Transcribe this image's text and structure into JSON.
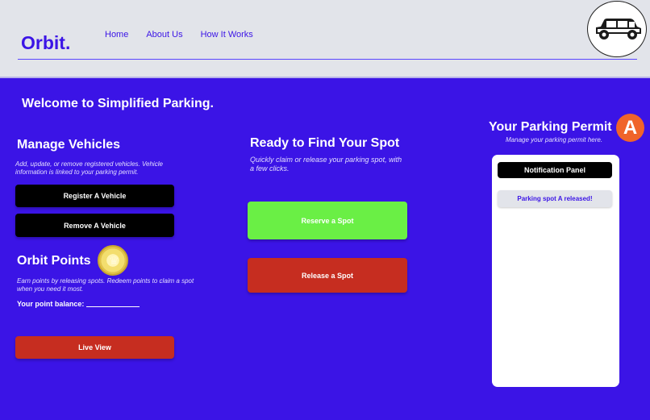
{
  "header": {
    "logo": "Orbit.",
    "nav": [
      "Home",
      "About Us",
      "How It Works"
    ]
  },
  "main": {
    "welcome": "Welcome to Simplified Parking."
  },
  "vehicles": {
    "title": "Manage Vehicles",
    "description": "Add, update, or remove registered vehicles. Vehicle information is linked to your parking permit.",
    "register_label": "Register A Vehicle",
    "remove_label": "Remove A Vehicle"
  },
  "points": {
    "title": "Orbit Points",
    "description": "Earn points by releasing spots. Redeem points to claim a spot when you need it most.",
    "balance_label": "Your point balance:",
    "live_view_label": "Live View"
  },
  "spot": {
    "title": "Ready to Find Your Spot",
    "description": "Quickly claim or release your parking spot, with a few clicks.",
    "reserve_label": "Reserve a Spot",
    "release_label": "Release a Spot"
  },
  "permit": {
    "title": "Your Parking Permit",
    "subtitle": "Manage your parking permit here.",
    "avatar_letter": "A",
    "notification_panel_label": "Notification Panel",
    "notifications": [
      "Parking spot A released!"
    ]
  },
  "colors": {
    "primary": "#3b14e6",
    "header_bg": "#e2e4ea",
    "green": "#6aef45",
    "red": "#c62d20",
    "avatar": "#f0642a"
  },
  "icons": {
    "header_avatar": "car-icon",
    "points_badge": "coin-icon"
  }
}
